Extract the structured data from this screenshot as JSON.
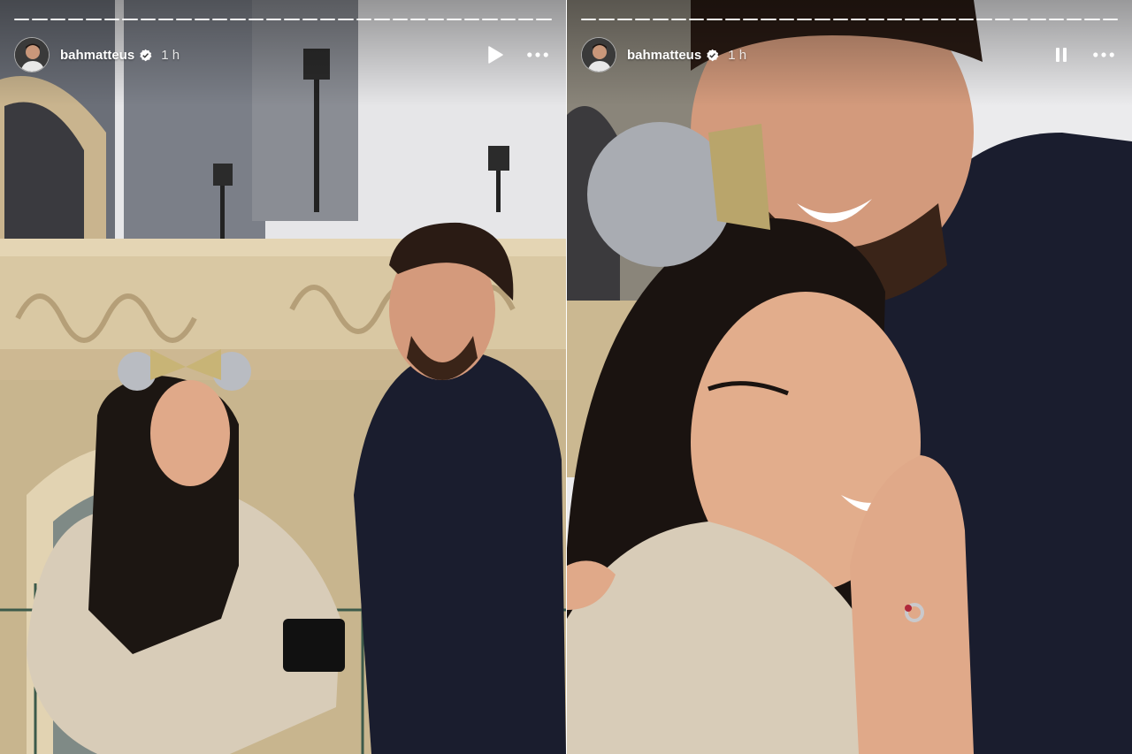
{
  "stories": [
    {
      "username": "bahmatteus",
      "time": "1 h",
      "playback_icon": "play-icon",
      "verified_icon": "verified-badge-icon",
      "more_icon": "more-options-icon",
      "photo_desc_icon": "story-photo"
    },
    {
      "username": "bahmatteus",
      "time": "1 h",
      "playback_icon": "pause-icon",
      "verified_icon": "verified-badge-icon",
      "more_icon": "more-options-icon",
      "photo_desc_icon": "story-photo"
    }
  ],
  "colors": {
    "progress": "#ffffff",
    "text": "#ffffff",
    "jacket_dark": "#1a1d2e",
    "jacket_beige": "#d8ccb8",
    "stone": "#d9c9a8",
    "sky": "#e8e8ea"
  }
}
